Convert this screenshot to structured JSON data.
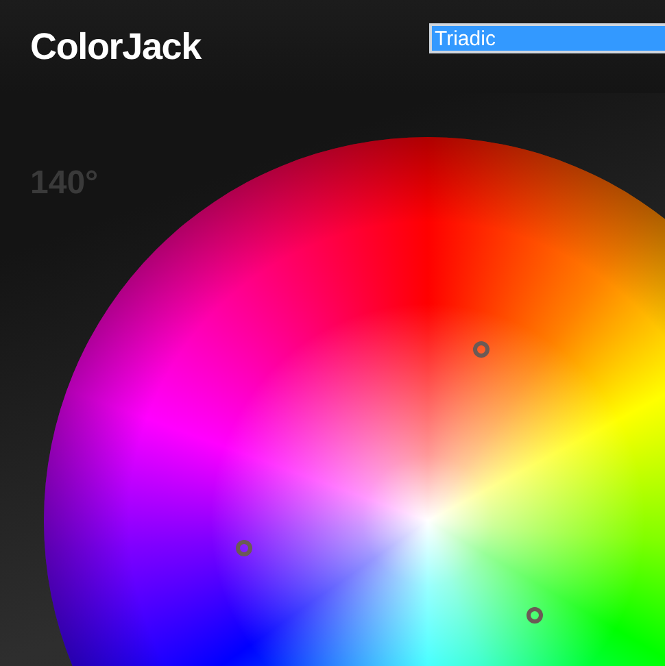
{
  "app": {
    "title": "ColorJack"
  },
  "scheme_select": {
    "value": "Triadic"
  },
  "wheel": {
    "angle": "140°"
  }
}
